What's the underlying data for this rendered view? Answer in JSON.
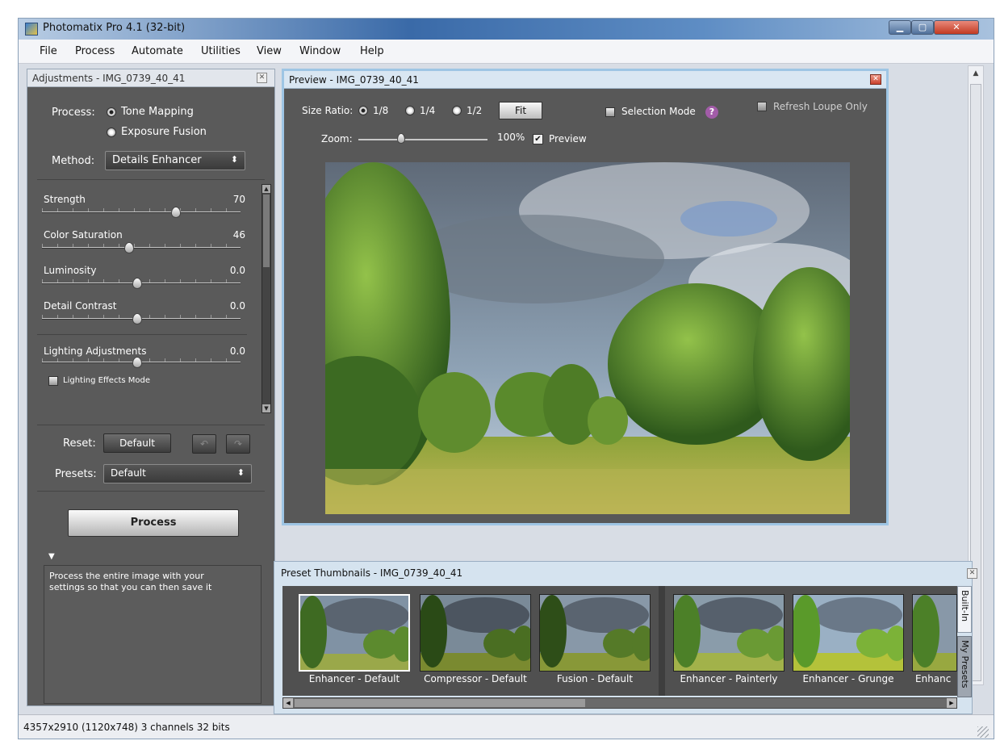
{
  "app": {
    "title": "Photomatix Pro 4.1 (32-bit)"
  },
  "menu": [
    "File",
    "Process",
    "Automate",
    "Utilities",
    "View",
    "Window",
    "Help"
  ],
  "adjustments": {
    "title": "Adjustments - IMG_0739_40_41",
    "process_label": "Process:",
    "process_options": [
      "Tone Mapping",
      "Exposure Fusion"
    ],
    "process_selected": "Tone Mapping",
    "method_label": "Method:",
    "method_value": "Details Enhancer",
    "sliders": [
      {
        "label": "Strength",
        "value": "70",
        "position": 0.7
      },
      {
        "label": "Color Saturation",
        "value": "46",
        "position": 0.46
      },
      {
        "label": "Luminosity",
        "value": "0.0",
        "position": 0.5
      },
      {
        "label": "Detail Contrast",
        "value": "0.0",
        "position": 0.5
      },
      {
        "label": "Lighting Adjustments",
        "value": "0.0",
        "position": 0.5
      }
    ],
    "lighting_effects_label": "Lighting Effects Mode",
    "reset_label": "Reset:",
    "reset_button": "Default",
    "presets_label": "Presets:",
    "presets_value": "Default",
    "process_button": "Process",
    "hint_arrow": "▼",
    "hint_text": "Process the entire image with your settings so that you can then save it"
  },
  "preview": {
    "title": "Preview - IMG_0739_40_41",
    "size_ratio_label": "Size Ratio:",
    "ratios": [
      "1/8",
      "1/4",
      "1/2"
    ],
    "ratio_selected": "1/8",
    "fit_button": "Fit",
    "selection_mode_label": "Selection Mode",
    "help_icon": "?",
    "refresh_loupe_label": "Refresh Loupe Only",
    "zoom_label": "Zoom:",
    "zoom_value": "100%",
    "preview_checkbox_label": "Preview",
    "preview_checked": true
  },
  "thumbnails": {
    "title": "Preset Thumbnails - IMG_0739_40_41",
    "items": [
      "Enhancer - Default",
      "Compressor - Default",
      "Fusion - Default",
      "Enhancer - Painterly",
      "Enhancer - Grunge",
      "Enhanc"
    ],
    "tabs": [
      "Built-In",
      "My Presets"
    ]
  },
  "status": {
    "text": "4357x2910 (1120x748) 3 channels 32 bits"
  },
  "colors": {
    "panel_bg": "#5a5a5a",
    "header_blue": "#d9e6f2",
    "accent_border": "#9ec5e4"
  }
}
